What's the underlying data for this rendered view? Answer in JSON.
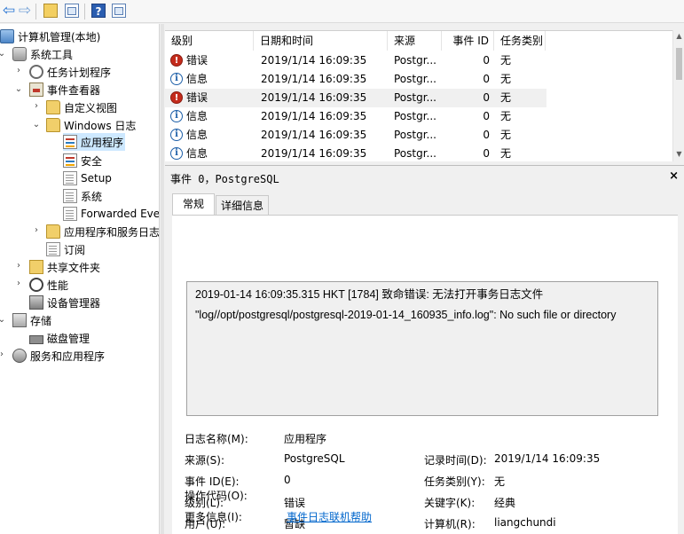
{
  "tree": {
    "root": "计算机管理(本地)",
    "system_tools": "系统工具",
    "task_scheduler": "任务计划程序",
    "event_viewer": "事件查看器",
    "custom_views": "自定义视图",
    "windows_logs": "Windows 日志",
    "application": "应用程序",
    "security": "安全",
    "setup": "Setup",
    "system": "系统",
    "forwarded": "Forwarded Eve",
    "apps_services": "应用程序和服务日志",
    "subscriptions": "订阅",
    "shared_folders": "共享文件夹",
    "performance": "性能",
    "device_manager": "设备管理器",
    "storage": "存储",
    "disk_management": "磁盘管理",
    "services_apps": "服务和应用程序"
  },
  "list": {
    "columns": [
      "级别",
      "日期和时间",
      "来源",
      "事件 ID",
      "任务类别"
    ],
    "rows": [
      {
        "level": "错误",
        "icon": "error-icon",
        "time": "2019/1/14 16:09:35",
        "source": "Postgr...",
        "event_id": "0",
        "category": "无"
      },
      {
        "level": "信息",
        "icon": "info-icon",
        "time": "2019/1/14 16:09:35",
        "source": "Postgr...",
        "event_id": "0",
        "category": "无"
      },
      {
        "level": "错误",
        "icon": "error-icon",
        "time": "2019/1/14 16:09:35",
        "source": "Postgr...",
        "event_id": "0",
        "category": "无"
      },
      {
        "level": "信息",
        "icon": "info-icon",
        "time": "2019/1/14 16:09:35",
        "source": "Postgr...",
        "event_id": "0",
        "category": "无"
      },
      {
        "level": "信息",
        "icon": "info-icon",
        "time": "2019/1/14 16:09:35",
        "source": "Postgr...",
        "event_id": "0",
        "category": "无"
      },
      {
        "level": "信息",
        "icon": "info-icon",
        "time": "2019/1/14 16:09:35",
        "source": "Postgr...",
        "event_id": "0",
        "category": "无"
      }
    ]
  },
  "detail": {
    "title": "事件 0，PostgreSQL",
    "close": "×",
    "tabs": [
      "常规",
      "详细信息"
    ],
    "message_line1": "2019-01-14 16:09:35.315 HKT [1784] 致命错误:  无法打开事务日志文件",
    "message_line2": "\"log//opt/postgresql/postgresql-2019-01-14_160935_info.log\": No such file or directory",
    "props": {
      "log_name_label": "日志名称(M):",
      "log_name": "应用程序",
      "source_label": "来源(S):",
      "source": "PostgreSQL",
      "logged_label": "记录时间(D):",
      "logged": "2019/1/14 16:09:35",
      "event_id_label": "事件 ID(E):",
      "event_id": "0",
      "task_cat_label": "任务类别(Y):",
      "task_cat": "无",
      "level_label": "级别(L):",
      "level": "错误",
      "keywords_label": "关键字(K):",
      "keywords": "经典",
      "user_label": "用户(U):",
      "user": "暂缺",
      "computer_label": "计算机(R):",
      "computer": "liangchundi",
      "opcode_label": "操作代码(O):",
      "more_info_label": "更多信息(I):",
      "more_info_link": "事件日志联机帮助"
    }
  },
  "colors": {
    "accent": "#1f6fd1",
    "error": "#c42b1c",
    "selection": "#cde8ff",
    "link": "#0066cc"
  }
}
